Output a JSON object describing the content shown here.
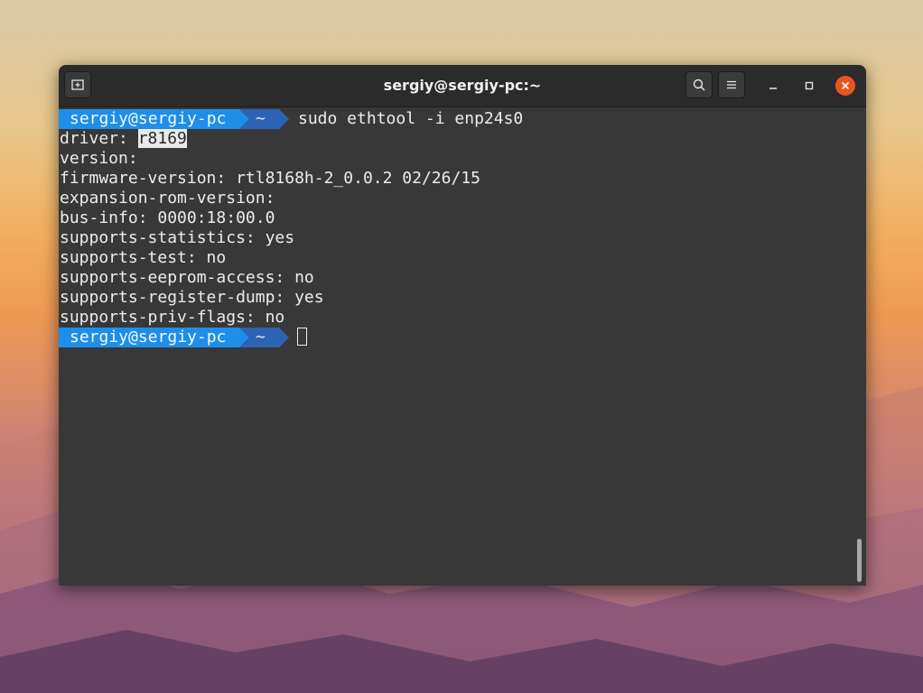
{
  "window": {
    "title": "sergiy@sergiy-pc:~"
  },
  "icons": {
    "new_tab": "new-tab-icon",
    "search": "search-icon",
    "menu": "hamburger-menu-icon",
    "minimize": "minimize-icon",
    "maximize": "maximize-icon",
    "close": "close-icon"
  },
  "colors": {
    "prompt_user_bg": "#1e8ee8",
    "prompt_dir_bg": "#2c63b4",
    "close_button": "#e9541f",
    "terminal_bg": "#383838",
    "text": "#ececec"
  },
  "terminal": {
    "prompt_user": "sergiy@sergiy-pc",
    "prompt_dir": "~",
    "command": "sudo ethtool -i enp24s0",
    "output": {
      "driver_label": "driver: ",
      "driver_value": "r8169",
      "lines": [
        "version:",
        "firmware-version: rtl8168h-2_0.0.2 02/26/15",
        "expansion-rom-version:",
        "bus-info: 0000:18:00.0",
        "supports-statistics: yes",
        "supports-test: no",
        "supports-eeprom-access: no",
        "supports-register-dump: yes",
        "supports-priv-flags: no"
      ]
    }
  }
}
